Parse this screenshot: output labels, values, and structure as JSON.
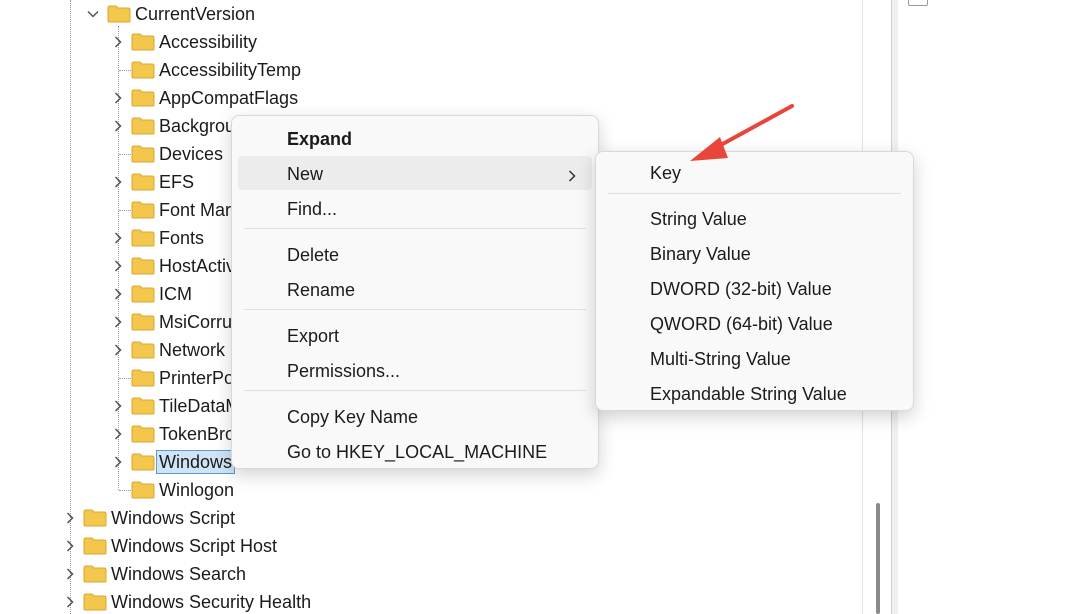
{
  "tree": {
    "parent": {
      "label": "CurrentVersion",
      "expanded": true
    },
    "children": [
      {
        "label": "Accessibility",
        "has_children": true
      },
      {
        "label": "AccessibilityTemp",
        "has_children": false
      },
      {
        "label": "AppCompatFlags",
        "has_children": true
      },
      {
        "label": "Backgrou",
        "has_children": true
      },
      {
        "label": "Devices",
        "has_children": false
      },
      {
        "label": "EFS",
        "has_children": true
      },
      {
        "label": "Font Mar",
        "has_children": false
      },
      {
        "label": "Fonts",
        "has_children": true
      },
      {
        "label": "HostActiv",
        "has_children": true
      },
      {
        "label": "ICM",
        "has_children": true
      },
      {
        "label": "MsiCorru",
        "has_children": true
      },
      {
        "label": "Network",
        "has_children": true
      },
      {
        "label": "PrinterPo",
        "has_children": false
      },
      {
        "label": "TileDataM",
        "has_children": true
      },
      {
        "label": "TokenBro",
        "has_children": true
      },
      {
        "label": "Windows",
        "has_children": true,
        "selected": true
      },
      {
        "label": "Winlogon",
        "has_children": false
      }
    ],
    "siblings": [
      {
        "label": "Windows Script",
        "has_children": true
      },
      {
        "label": "Windows Script Host",
        "has_children": true
      },
      {
        "label": "Windows Search",
        "has_children": true
      },
      {
        "label": "Windows Security Health",
        "has_children": true
      }
    ]
  },
  "context_menu": {
    "items": [
      {
        "label": "Expand",
        "bold": true
      },
      {
        "label": "New",
        "submenu": true,
        "hover": true
      },
      {
        "label": "Find..."
      },
      {
        "label": "Delete"
      },
      {
        "label": "Rename"
      },
      {
        "label": "Export"
      },
      {
        "label": "Permissions..."
      },
      {
        "label": "Copy Key Name"
      },
      {
        "label": "Go to HKEY_LOCAL_MACHINE"
      }
    ]
  },
  "new_submenu": {
    "items": [
      {
        "label": "Key"
      },
      {
        "label": "String Value"
      },
      {
        "label": "Binary Value"
      },
      {
        "label": "DWORD (32-bit) Value"
      },
      {
        "label": "QWORD (64-bit) Value"
      },
      {
        "label": "Multi-String Value"
      },
      {
        "label": "Expandable String Value"
      }
    ]
  },
  "colors": {
    "folder": "#f3c64c",
    "selection": "#cfe4f7",
    "annotation_arrow": "#e8463a"
  }
}
